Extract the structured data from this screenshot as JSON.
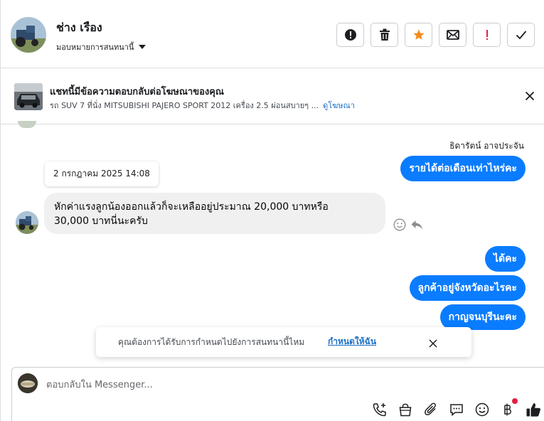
{
  "header": {
    "contact_name": "ช่าง เรือง",
    "assign_label": "มอบหมายการสนทนานี้"
  },
  "ad_banner": {
    "title": "แชทนี้มีข้อความตอบกลับต่อโฆษณาของคุณ",
    "subtitle": "รถ SUV 7 ที่นั่ง MITSUBISHI PAJERO SPORT 2012 เครื่อง 2.5 ผ่อนสบายๆ ...",
    "link": "ดูโฆษณา"
  },
  "conversation": {
    "sender_name": "ธิดารัตน์ อาจประจัน",
    "date_chip": "2 กรกฎาคม 2025 14:08",
    "messages": [
      {
        "direction": "outgoing",
        "text": "รายได้ต่อเดือนเท่าไหร่คะ"
      },
      {
        "direction": "incoming",
        "line1": "หักค่าแรงลูกน้องออกแล้วก็จะเหลืออยู่ประมาณ 20,000 บาทหรือ",
        "line2": "30,000 บาทนี่นะครับ"
      },
      {
        "direction": "outgoing",
        "text": "ได้คะ"
      },
      {
        "direction": "outgoing",
        "text": "ลูกค้าอยู่จังหวัดอะไรคะ"
      },
      {
        "direction": "outgoing",
        "text": "กาญจนบุรีนะคะ"
      }
    ]
  },
  "toast": {
    "text": "คุณต้องการได้รับการกำหนดไปยังการสนทนานี้ไหม",
    "link": "กำหนดให้ฉัน"
  },
  "composer": {
    "placeholder": "ตอบกลับใน Messenger...",
    "tools": [
      "call-add-icon",
      "shopping-bag-icon",
      "paperclip-icon",
      "chat-bubble-icon",
      "emoji-icon",
      "baht-icon",
      "thumbs-up-icon"
    ]
  },
  "colors": {
    "accent": "#0a7cff",
    "link": "#1a6fc4",
    "star": "#f28b1c",
    "alert": "#e41e3f"
  }
}
